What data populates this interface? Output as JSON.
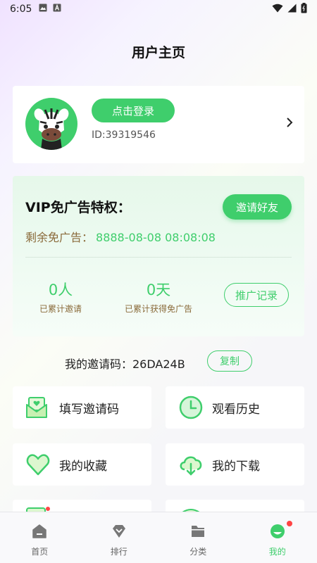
{
  "status_bar": {
    "time": "6:05"
  },
  "header": {
    "title": "用户主页"
  },
  "profile": {
    "login_label": "点击登录",
    "user_id": "ID:39319546"
  },
  "vip": {
    "title": "VIP免广告特权：",
    "invite_label": "邀请好友",
    "remain_label": "剩余免广告：",
    "remain_value": "8888-08-08 08:08:08",
    "invited_count": "0人",
    "invited_caption": "已累计邀请",
    "free_days": "0天",
    "free_days_caption": "已累计获得免广告",
    "promo_label": "推广记录"
  },
  "invite_code": {
    "text": "我的邀请码：26DA24B",
    "copy_label": "复制"
  },
  "menu": {
    "fill_code": "填写邀请码",
    "history": "观看历史",
    "favorites": "我的收藏",
    "downloads": "我的下载"
  },
  "tabs": [
    {
      "label": "首页",
      "icon": "home-icon"
    },
    {
      "label": "排行",
      "icon": "rank-icon"
    },
    {
      "label": "分类",
      "icon": "folder-icon"
    },
    {
      "label": "我的",
      "icon": "profile-icon"
    }
  ],
  "colors": {
    "accent": "#3fce6c",
    "gold_text": "#8a6a3a",
    "badge": "#ff4444"
  }
}
